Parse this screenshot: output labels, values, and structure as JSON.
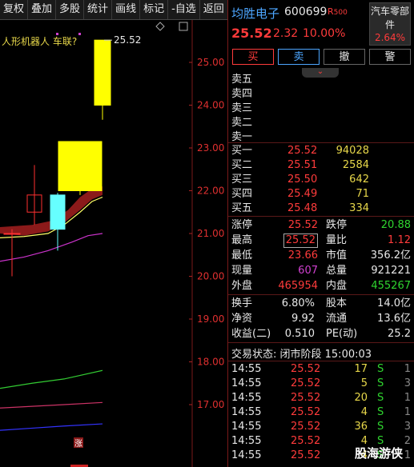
{
  "toolbar": {
    "items": [
      "复权",
      "叠加",
      "多股",
      "统计",
      "画线",
      "标记",
      "-自选",
      "返回"
    ]
  },
  "chart": {
    "annotation": "人形机器人 车联?",
    "high_label": "25.52",
    "y_ticks": [
      "25.00",
      "24.00",
      "23.00",
      "22.00",
      "21.00",
      "20.00",
      "19.00",
      "18.00",
      "17.00"
    ],
    "limit_marker": "涨",
    "colors": {
      "up": "#ffff00",
      "down": "#66ffff",
      "ma5": "#ffff66",
      "ma10": "#cc33cc",
      "ma20": "#33cc33",
      "ma60": "#cc3366",
      "ma120": "#3333ff",
      "band": "#8b1a1a"
    }
  },
  "stock": {
    "name": "均胜电子",
    "code": "600699",
    "flag": "R",
    "flag_suffix": "500",
    "price": "25.52",
    "change": "2.32",
    "pct": "10.00%",
    "sector_name": "汽车零部件",
    "sector_pct": "2.64%"
  },
  "actions": {
    "buy": "买",
    "sell": "卖",
    "cancel": "撤",
    "alert": "警"
  },
  "sell_levels": [
    "卖五",
    "卖四",
    "卖三",
    "卖二",
    "卖一"
  ],
  "buy_levels": [
    {
      "label": "买一",
      "price": "25.52",
      "vol": "94028"
    },
    {
      "label": "买二",
      "price": "25.51",
      "vol": "2584"
    },
    {
      "label": "买三",
      "price": "25.50",
      "vol": "642"
    },
    {
      "label": "买四",
      "price": "25.49",
      "vol": "71"
    },
    {
      "label": "买五",
      "price": "25.48",
      "vol": "334"
    }
  ],
  "stats": [
    {
      "l1": "涨停",
      "v1": "25.52",
      "c1": "red",
      "l2": "跌停",
      "v2": "20.88",
      "c2": "green"
    },
    {
      "l1": "最高",
      "v1": "25.52",
      "c1": "red",
      "l2": "量比",
      "v2": "1.12",
      "c2": "red"
    },
    {
      "l1": "最低",
      "v1": "23.66",
      "c1": "red",
      "l2": "市值",
      "v2": "356.2亿",
      "c2": "white"
    },
    {
      "l1": "现量",
      "v1": "607",
      "c1": "mag",
      "l2": "总量",
      "v2": "921221",
      "c2": "white"
    },
    {
      "l1": "外盘",
      "v1": "465954",
      "c1": "red",
      "l2": "内盘",
      "v2": "455267",
      "c2": "green"
    }
  ],
  "fin": [
    {
      "l1": "换手",
      "v1": "6.80%",
      "l2": "股本",
      "v2": "14.0亿"
    },
    {
      "l1": "净资",
      "v1": "9.92",
      "l2": "流通",
      "v2": "13.6亿"
    },
    {
      "l1": "收益(二)",
      "v1": "0.510",
      "l2": "PE(动)",
      "v2": "25.2"
    }
  ],
  "trade_status": "交易状态: 闭市阶段 15:00:03",
  "ticks": [
    {
      "t": "14:55",
      "p": "25.52",
      "v": "17",
      "s": "S",
      "n": "1"
    },
    {
      "t": "14:55",
      "p": "25.52",
      "v": "5",
      "s": "S",
      "n": "3"
    },
    {
      "t": "14:55",
      "p": "25.52",
      "v": "20",
      "s": "S",
      "n": "1"
    },
    {
      "t": "14:55",
      "p": "25.52",
      "v": "4",
      "s": "S",
      "n": "1"
    },
    {
      "t": "14:55",
      "p": "25.52",
      "v": "36",
      "s": "S",
      "n": "3"
    },
    {
      "t": "14:55",
      "p": "25.52",
      "v": "4",
      "s": "S",
      "n": "2"
    },
    {
      "t": "14:55",
      "p": "25.52",
      "v": "4",
      "s": "S",
      "n": "1"
    }
  ],
  "watermark": "股海游侠"
}
